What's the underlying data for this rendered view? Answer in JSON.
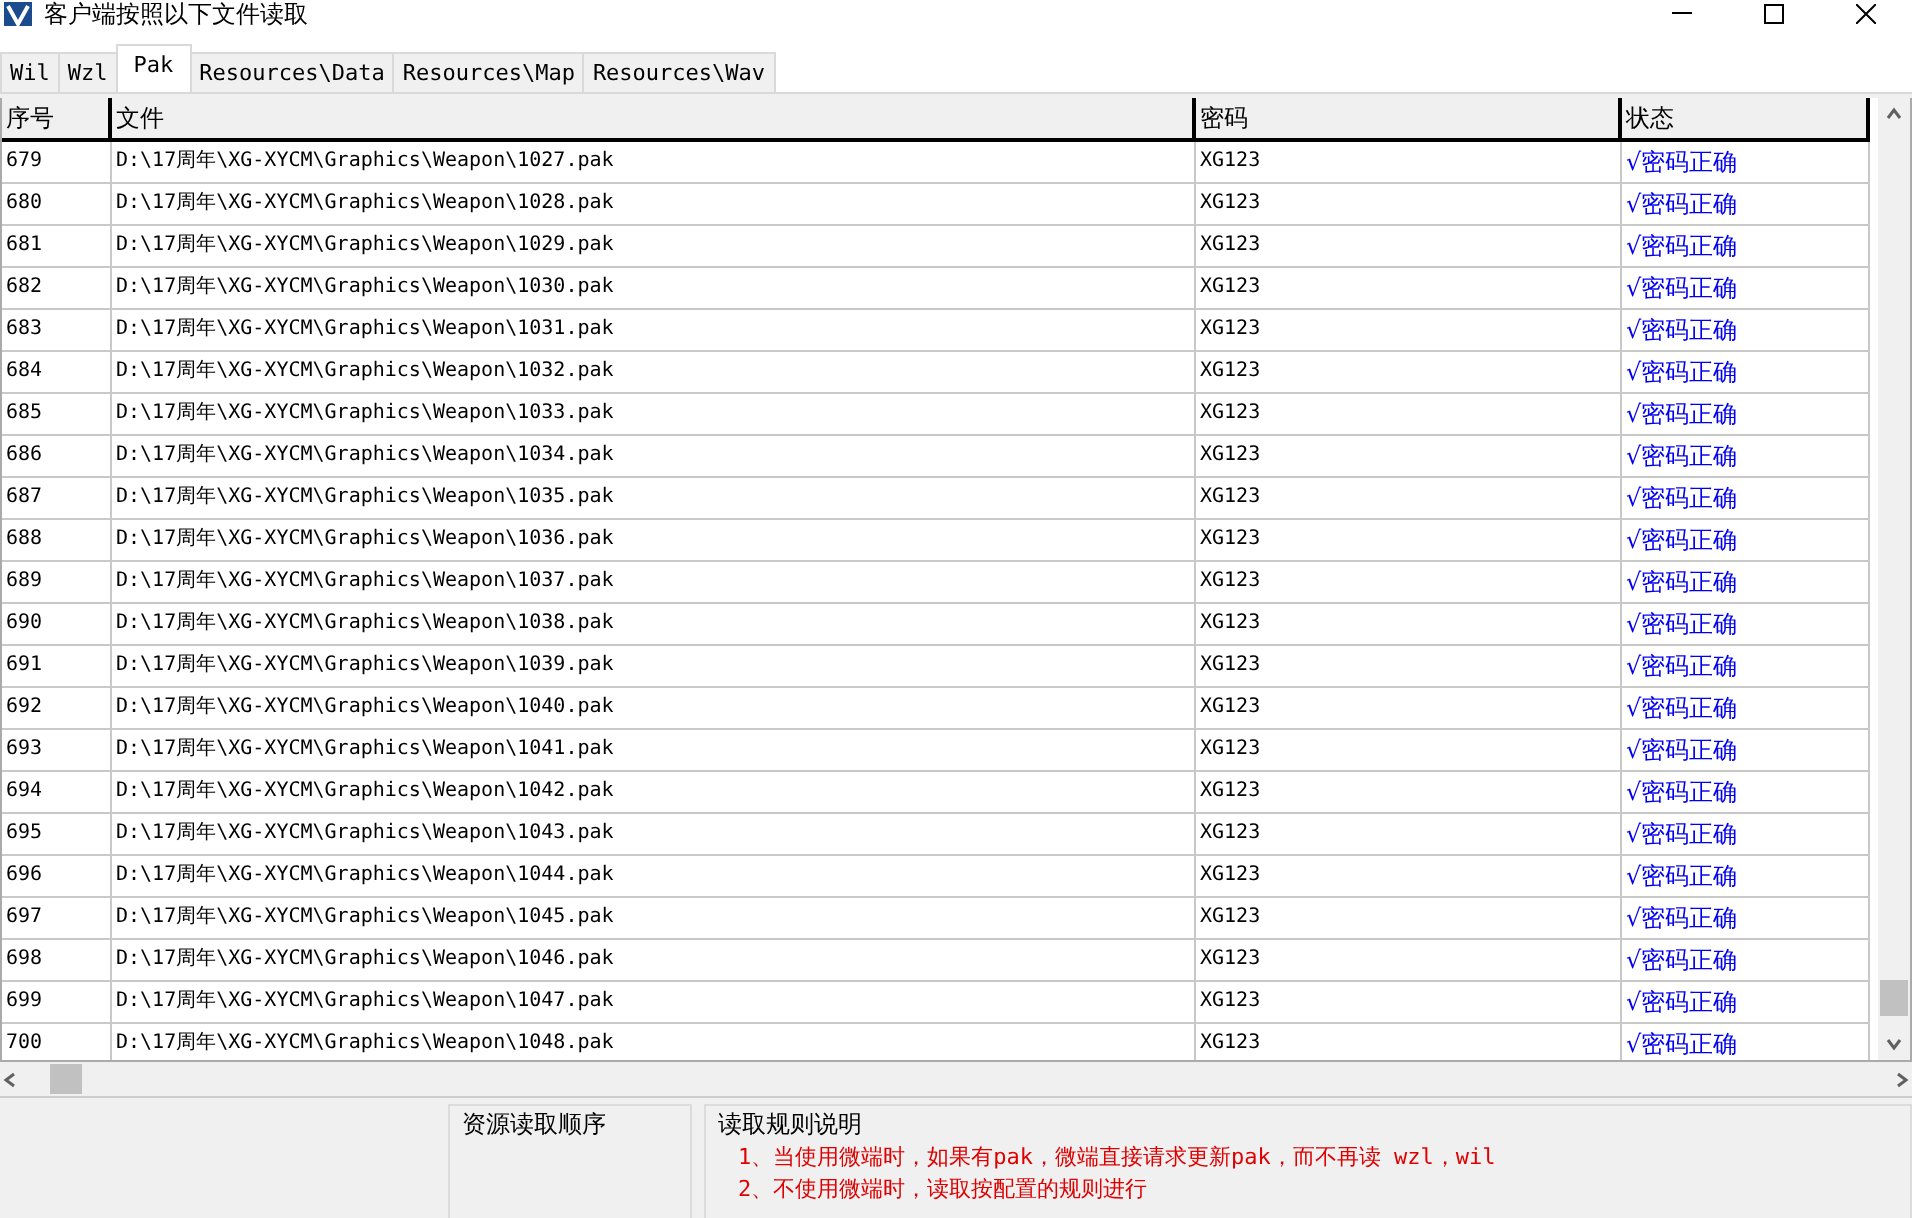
{
  "window": {
    "title": "客户端按照以下文件读取"
  },
  "tabs": [
    {
      "label": "Wil",
      "selected": false
    },
    {
      "label": "Wzl",
      "selected": false
    },
    {
      "label": "Pak",
      "selected": true
    },
    {
      "label": "Resources\\Data",
      "selected": false
    },
    {
      "label": "Resources\\Map",
      "selected": false
    },
    {
      "label": "Resources\\Wav",
      "selected": false
    }
  ],
  "table": {
    "columns": [
      "序号",
      "文件",
      "密码",
      "状态"
    ],
    "rows": [
      [
        "679",
        "D:\\17周年\\XG-XYCM\\Graphics\\Weapon\\1027.pak",
        "XG123",
        "√密码正确"
      ],
      [
        "680",
        "D:\\17周年\\XG-XYCM\\Graphics\\Weapon\\1028.pak",
        "XG123",
        "√密码正确"
      ],
      [
        "681",
        "D:\\17周年\\XG-XYCM\\Graphics\\Weapon\\1029.pak",
        "XG123",
        "√密码正确"
      ],
      [
        "682",
        "D:\\17周年\\XG-XYCM\\Graphics\\Weapon\\1030.pak",
        "XG123",
        "√密码正确"
      ],
      [
        "683",
        "D:\\17周年\\XG-XYCM\\Graphics\\Weapon\\1031.pak",
        "XG123",
        "√密码正确"
      ],
      [
        "684",
        "D:\\17周年\\XG-XYCM\\Graphics\\Weapon\\1032.pak",
        "XG123",
        "√密码正确"
      ],
      [
        "685",
        "D:\\17周年\\XG-XYCM\\Graphics\\Weapon\\1033.pak",
        "XG123",
        "√密码正确"
      ],
      [
        "686",
        "D:\\17周年\\XG-XYCM\\Graphics\\Weapon\\1034.pak",
        "XG123",
        "√密码正确"
      ],
      [
        "687",
        "D:\\17周年\\XG-XYCM\\Graphics\\Weapon\\1035.pak",
        "XG123",
        "√密码正确"
      ],
      [
        "688",
        "D:\\17周年\\XG-XYCM\\Graphics\\Weapon\\1036.pak",
        "XG123",
        "√密码正确"
      ],
      [
        "689",
        "D:\\17周年\\XG-XYCM\\Graphics\\Weapon\\1037.pak",
        "XG123",
        "√密码正确"
      ],
      [
        "690",
        "D:\\17周年\\XG-XYCM\\Graphics\\Weapon\\1038.pak",
        "XG123",
        "√密码正确"
      ],
      [
        "691",
        "D:\\17周年\\XG-XYCM\\Graphics\\Weapon\\1039.pak",
        "XG123",
        "√密码正确"
      ],
      [
        "692",
        "D:\\17周年\\XG-XYCM\\Graphics\\Weapon\\1040.pak",
        "XG123",
        "√密码正确"
      ],
      [
        "693",
        "D:\\17周年\\XG-XYCM\\Graphics\\Weapon\\1041.pak",
        "XG123",
        "√密码正确"
      ],
      [
        "694",
        "D:\\17周年\\XG-XYCM\\Graphics\\Weapon\\1042.pak",
        "XG123",
        "√密码正确"
      ],
      [
        "695",
        "D:\\17周年\\XG-XYCM\\Graphics\\Weapon\\1043.pak",
        "XG123",
        "√密码正确"
      ],
      [
        "696",
        "D:\\17周年\\XG-XYCM\\Graphics\\Weapon\\1044.pak",
        "XG123",
        "√密码正确"
      ],
      [
        "697",
        "D:\\17周年\\XG-XYCM\\Graphics\\Weapon\\1045.pak",
        "XG123",
        "√密码正确"
      ],
      [
        "698",
        "D:\\17周年\\XG-XYCM\\Graphics\\Weapon\\1046.pak",
        "XG123",
        "√密码正确"
      ],
      [
        "699",
        "D:\\17周年\\XG-XYCM\\Graphics\\Weapon\\1047.pak",
        "XG123",
        "√密码正确"
      ],
      [
        "700",
        "D:\\17周年\\XG-XYCM\\Graphics\\Weapon\\1048.pak",
        "XG123",
        "√密码正确"
      ]
    ]
  },
  "groups": [
    {
      "title": "资源读取顺序"
    },
    {
      "title": "读取规则说明",
      "lines": [
        "1、当使用微端时，如果有pak，微端直接请求更新pak，而不再读 wzl，wil",
        "2、不使用微端时，读取按配置的规则进行"
      ]
    }
  ]
}
